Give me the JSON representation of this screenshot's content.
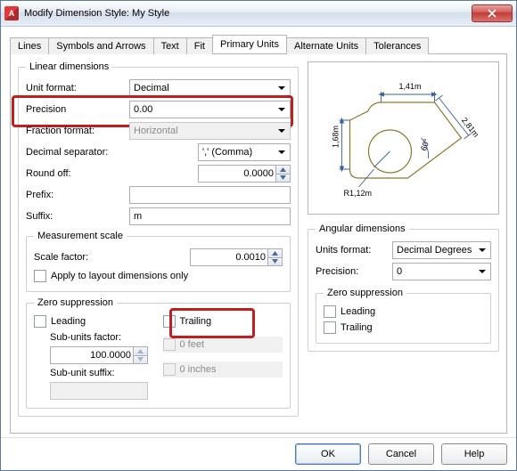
{
  "window": {
    "title": "Modify Dimension Style: My Style"
  },
  "tabs": [
    "Lines",
    "Symbols and Arrows",
    "Text",
    "Fit",
    "Primary Units",
    "Alternate Units",
    "Tolerances"
  ],
  "activeTab": "Primary Units",
  "linear": {
    "legend": "Linear dimensions",
    "unitFormat": {
      "label": "Unit format:",
      "value": "Decimal"
    },
    "precision": {
      "label": "Precision",
      "value": "0.00"
    },
    "fractionFormat": {
      "label": "Fraction format:",
      "value": "Horizontal"
    },
    "decimalSep": {
      "label": "Decimal separator:",
      "value": "',' (Comma)"
    },
    "roundOff": {
      "label": "Round off:",
      "value": "0.0000"
    },
    "prefix": {
      "label": "Prefix:",
      "value": ""
    },
    "suffix": {
      "label": "Suffix:",
      "value": "m"
    }
  },
  "mscale": {
    "legend": "Measurement scale",
    "scaleFactor": {
      "label": "Scale factor:",
      "value": "0.0010"
    },
    "applyLayout": "Apply to layout dimensions only"
  },
  "zsup": {
    "legend": "Zero suppression",
    "leading": "Leading",
    "trailing": "Trailing",
    "subFactor": {
      "label": "Sub-units factor:",
      "value": "100.0000"
    },
    "subSuffix": {
      "label": "Sub-unit suffix:",
      "value": ""
    },
    "feet": "0 feet",
    "inches": "0 inches"
  },
  "preview": {
    "top": "1,41m",
    "left": "1,68m",
    "radius": "R1,12m",
    "right": "2,81m",
    "angle": "60°"
  },
  "angular": {
    "legend": "Angular dimensions",
    "unitsFormat": {
      "label": "Units format:",
      "value": "Decimal Degrees"
    },
    "precision": {
      "label": "Precision:",
      "value": "0"
    },
    "zsup": {
      "legend": "Zero suppression",
      "leading": "Leading",
      "trailing": "Trailing"
    }
  },
  "buttons": {
    "ok": "OK",
    "cancel": "Cancel",
    "help": "Help"
  }
}
